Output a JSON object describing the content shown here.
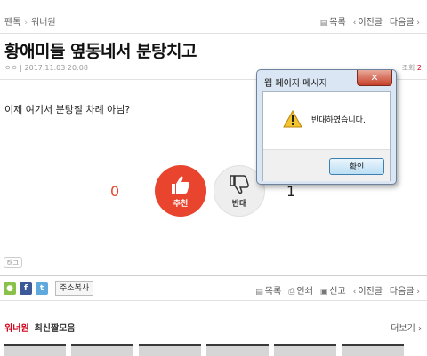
{
  "breadcrumb": {
    "home": "펜톡",
    "board": "워너원"
  },
  "topnav": {
    "list": "목록",
    "prev": "이전글",
    "next": "다음글"
  },
  "post": {
    "title": "황애미들 옆동네서 분탕치고",
    "author": "ㅇㅇ",
    "date": "2017.11.03 20:08",
    "views_label": "조회",
    "views_value": "2",
    "body": "이제 여기서 분탕칠 차례 아님?"
  },
  "vote": {
    "up_count": "0",
    "up_label": "추천",
    "down_label": "반대",
    "down_count": "1"
  },
  "tag_label": "태그",
  "share": {
    "copy_label": "주소복사"
  },
  "botnav": {
    "list": "목록",
    "print": "인쇄",
    "report": "신고",
    "prev": "이전글",
    "next": "다음글"
  },
  "latest": {
    "board": "워너원",
    "title": "최신짤모음",
    "more": "더보기"
  },
  "dialog": {
    "title": "웹 페이지 메시지",
    "message": "반대하였습니다.",
    "ok_label": "확인",
    "close_glyph": "✕"
  },
  "colors": {
    "accent_red": "#e8442e",
    "link_red": "#d0021b",
    "dialog_frame": "#dbe6f4"
  },
  "icons": {
    "list": "list-icon",
    "print": "printer-icon",
    "report": "report-icon",
    "warning": "warning-icon"
  }
}
